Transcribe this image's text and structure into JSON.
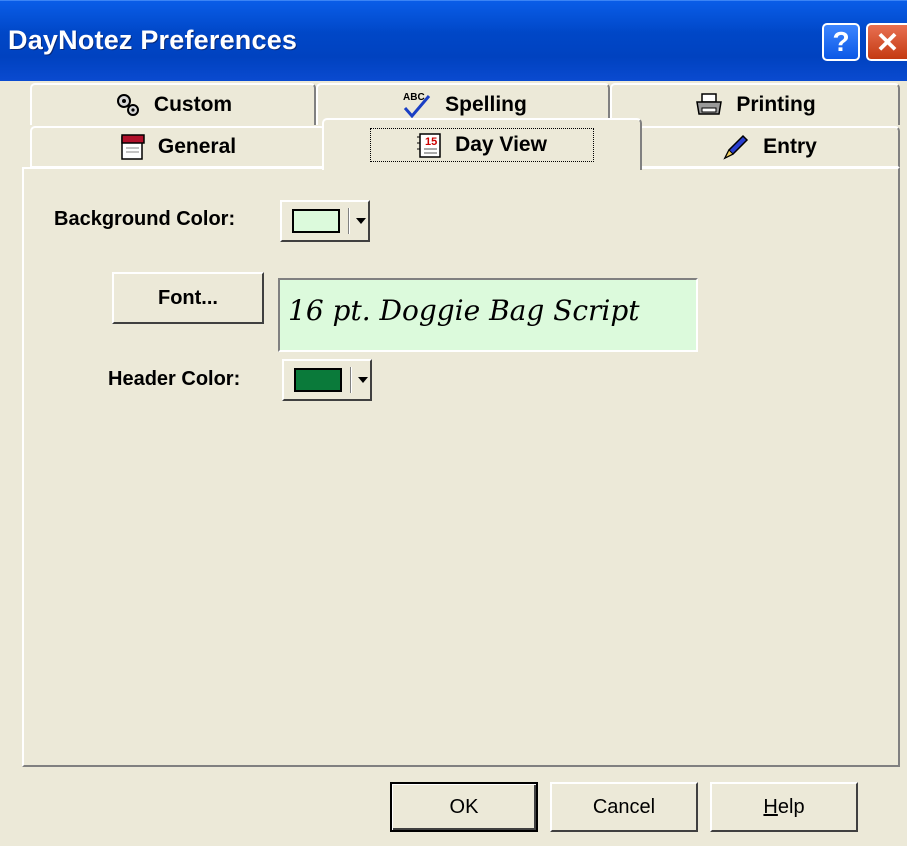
{
  "window": {
    "title": "DayNotez Preferences",
    "help_glyph": "?",
    "close_glyph": "✕"
  },
  "tabs": {
    "custom": {
      "label": "Custom",
      "icon": "gears-icon"
    },
    "spelling": {
      "label": "Spelling",
      "icon": "spellcheck-icon"
    },
    "printing": {
      "label": "Printing",
      "icon": "printer-icon"
    },
    "general": {
      "label": "General",
      "icon": "notebook-icon"
    },
    "day_view": {
      "label": "Day View",
      "icon": "calendar-icon",
      "calendar_num": "15"
    },
    "entry": {
      "label": "Entry",
      "icon": "pen-icon"
    }
  },
  "spelling_icon_text": "ABC",
  "day_view": {
    "background_color_label": "Background Color:",
    "background_color_value": "#dcfadc",
    "font_button_label": "Font...",
    "font_preview": "16 pt. Doggie Bag Script",
    "header_color_label": "Header Color:",
    "header_color_value": "#0a7a3a"
  },
  "buttons": {
    "ok": "OK",
    "cancel": "Cancel",
    "help_prefix": "H",
    "help_rest": "elp"
  }
}
